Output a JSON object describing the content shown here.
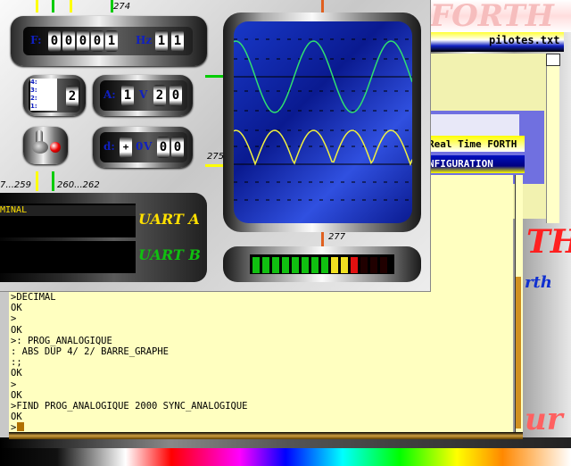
{
  "background": {
    "title_fragment": "FORTH",
    "file_name": "pilotes.txt",
    "real_time_label": "Real Time FORTH",
    "config_label": "NFIGURATION",
    "red_fragment": "TH",
    "blue_fragment": "rth",
    "bottom_fragment": "ur"
  },
  "panel": {
    "frequency": {
      "label": "F:",
      "digits": [
        "0",
        "0",
        "0",
        "0",
        "1"
      ],
      "unit": "Hz",
      "extra_digits": [
        "1",
        "1"
      ]
    },
    "waveform": {
      "labels": "4:\n3:\n2:\n1:",
      "value": "2"
    },
    "amplitude": {
      "label": "A:",
      "digits": [
        "1"
      ],
      "unit": "V",
      "extra_digits": [
        "2",
        "0"
      ]
    },
    "offset": {
      "label": "d:",
      "sign": "+",
      "digit": "0",
      "unit": "V",
      "extra_digits": [
        "0",
        "0"
      ]
    },
    "uart_a": "UART A",
    "uart_b": "UART B",
    "terminal_label": "MINAL",
    "wire_numbers": {
      "n274": "274",
      "n275": "275",
      "n277": "277",
      "n259": "7...259",
      "n260": "260...262"
    }
  },
  "bargraph": {
    "levels": 14,
    "lit": 11
  },
  "terminal": {
    "lines": [
      ">DECIMAL",
      "OK",
      ">",
      "OK",
      ">: PROG_ANALOGIQUE",
      ": ABS DUP 4/ 2/ BARRE_GRAPHE",
      ":;",
      "OK",
      ">",
      "OK",
      ">FIND PROG_ANALOGIQUE 2000 SYNC_ANALOGIQUE",
      "OK",
      ">"
    ]
  },
  "colors": {
    "accent_blue": "#1020c0",
    "uart_a": "#ffe000",
    "uart_b": "#10c010",
    "terminal_bg": "#ffffc0"
  }
}
